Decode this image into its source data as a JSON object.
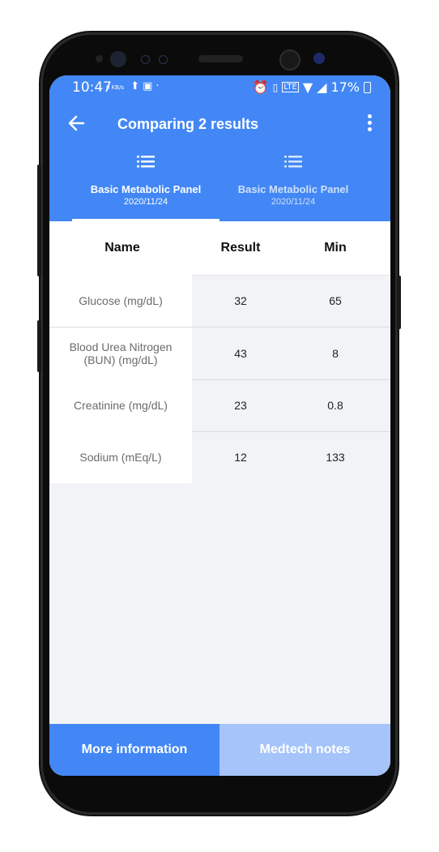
{
  "status_bar": {
    "time": "10:47",
    "net_speed": "0 KB/s",
    "battery": "17%"
  },
  "app_bar": {
    "title": "Comparing 2 results"
  },
  "tabs": [
    {
      "label": "Basic Metabolic Panel",
      "date": "2020/11/24",
      "active": true
    },
    {
      "label": "Basic Metabolic Panel",
      "date": "2020/11/24",
      "active": false
    }
  ],
  "table": {
    "headers": {
      "name": "Name",
      "result": "Result",
      "min": "Min"
    },
    "rows": [
      {
        "name": "Glucose (mg/dL)",
        "result": "32",
        "min": "65"
      },
      {
        "name": "Blood Urea Nitrogen (BUN) (mg/dL)",
        "result": "43",
        "min": "8"
      },
      {
        "name": "Creatinine (mg/dL)",
        "result": "23",
        "min": "0.8"
      },
      {
        "name": "Sodium (mEq/L)",
        "result": "12",
        "min": "133"
      }
    ]
  },
  "buttons": {
    "more_info": "More information",
    "medtech_notes": "Medtech notes"
  },
  "colors": {
    "primary": "#4287f5",
    "secondary_button": "#a5c4f9",
    "background": "#f2f3f7"
  }
}
